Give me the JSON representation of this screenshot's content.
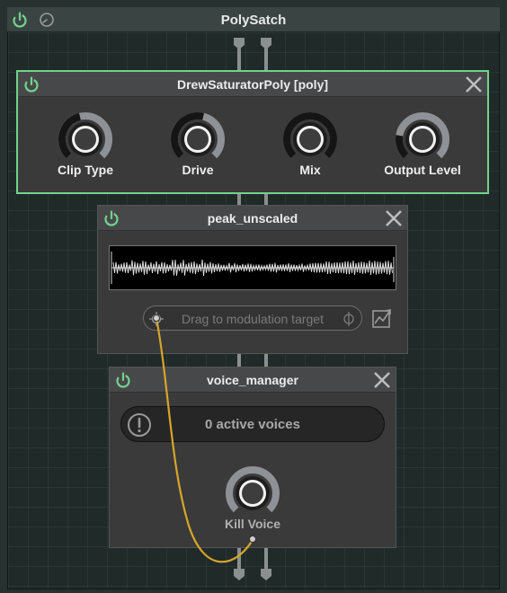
{
  "window": {
    "title": "PolySatch",
    "power_icon": "power-icon",
    "gauge_icon": "gauge-icon"
  },
  "devices": [
    {
      "title": "DrewSaturatorPoly [poly]",
      "knobs": [
        {
          "label": "Clip Type",
          "value": 0.45
        },
        {
          "label": "Drive",
          "value": 0.55
        },
        {
          "label": "Mix",
          "value": 1.0
        },
        {
          "label": "Output Level",
          "value": 0.2
        }
      ]
    },
    {
      "title": "peak_unscaled",
      "mod_target_text": "Drag to modulation target"
    },
    {
      "title": "voice_manager",
      "status_text": "0 active voices",
      "knob": {
        "label": "Kill Voice",
        "value": 0.0
      }
    }
  ],
  "colors": {
    "power_on": "#72d28c",
    "cable": "#d7a52a",
    "selected_border": "#72d28c"
  }
}
